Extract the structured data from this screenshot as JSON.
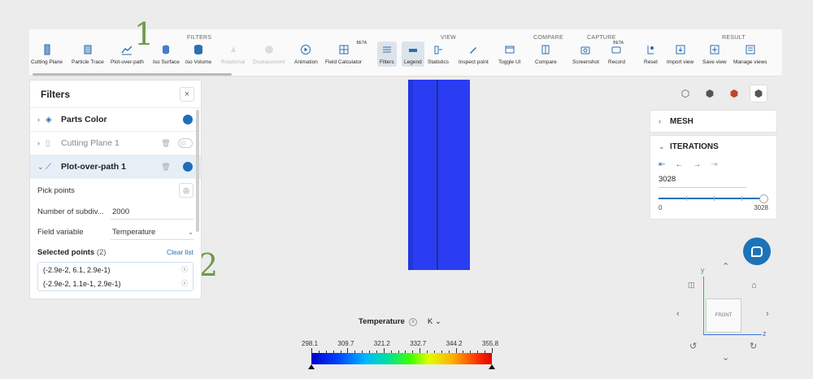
{
  "toolbar": {
    "groups": {
      "filters": "FILTERS",
      "view": "VIEW",
      "compare": "COMPARE",
      "capture": "CAPTURE",
      "result": "RESULT"
    },
    "filters_tools": [
      {
        "label": "Cutting Plane",
        "icon": "cutting-plane-icon"
      },
      {
        "label": "Particle Trace",
        "icon": "particle-trace-icon"
      },
      {
        "label": "Plot-over-path",
        "icon": "plot-over-path-icon"
      },
      {
        "label": "Iso Surface",
        "icon": "iso-surface-icon"
      },
      {
        "label": "Iso Volume",
        "icon": "iso-volume-icon"
      },
      {
        "label": "Rotational",
        "icon": "rotational-icon"
      },
      {
        "label": "Displacement",
        "icon": "displacement-icon"
      },
      {
        "label": "Animation",
        "icon": "animation-icon"
      },
      {
        "label": "Field Calculator",
        "icon": "field-calculator-icon",
        "badge": "BETA"
      }
    ],
    "view_tools": [
      {
        "label": "Filters",
        "icon": "filters-icon"
      },
      {
        "label": "Legend",
        "icon": "legend-icon"
      },
      {
        "label": "Statistics",
        "icon": "statistics-icon"
      },
      {
        "label": "Inspect point",
        "icon": "inspect-point-icon"
      },
      {
        "label": "Toggle UI",
        "icon": "toggle-ui-icon"
      }
    ],
    "compare_tools": [
      {
        "label": "Compare",
        "icon": "compare-icon"
      }
    ],
    "capture_tools": [
      {
        "label": "Screenshot",
        "icon": "screenshot-icon"
      },
      {
        "label": "Record",
        "icon": "record-icon",
        "badge": "BETA"
      }
    ],
    "result_tools": [
      {
        "label": "Reset",
        "icon": "reset-icon"
      },
      {
        "label": "Import view",
        "icon": "import-view-icon"
      },
      {
        "label": "Save view",
        "icon": "save-view-icon"
      },
      {
        "label": "Manage views",
        "icon": "manage-views-icon"
      }
    ]
  },
  "annotations": {
    "one": "1",
    "two": "2"
  },
  "filters_panel": {
    "title": "Filters",
    "close": "×",
    "items": [
      {
        "label": "Parts Color",
        "enabled": true
      },
      {
        "label": "Cutting Plane 1",
        "enabled": false
      },
      {
        "label": "Plot-over-path 1",
        "enabled": true
      }
    ],
    "pick_points_label": "Pick points",
    "subdiv_label": "Number of subdiv...",
    "subdiv_value": "2000",
    "field_label": "Field variable",
    "field_value": "Temperature",
    "selected_label": "Selected points",
    "selected_count": "(2)",
    "clear_list": "Clear list",
    "points": [
      "(-2.9e-2, 6.1, 2.9e-1)",
      "(-2.9e-2, 1.1e-1, 2.9e-1)"
    ]
  },
  "right_panel": {
    "mesh": "MESH",
    "iterations": "ITERATIONS",
    "iteration_value": "3028",
    "slider_min": "0",
    "slider_max": "3028",
    "slider_fraction": 1.0
  },
  "nav": {
    "front": "FRONT",
    "y": "y",
    "z": "z"
  },
  "legend": {
    "title": "Temperature",
    "unit": "K",
    "ticks": [
      "298.1",
      "309.7",
      "321.2",
      "332.7",
      "344.2",
      "355.8"
    ]
  }
}
